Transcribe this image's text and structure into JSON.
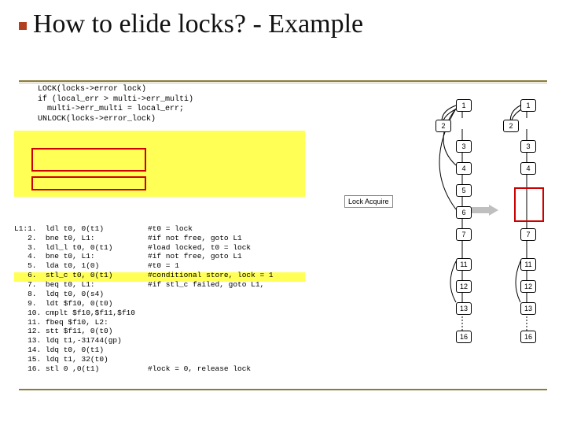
{
  "title": "How to elide locks? - Example",
  "c_code": "LOCK(locks->error lock)\nif (local_err > multi->err_multi)\n  multi->err_multi = local_err;\nUNLOCK(locks->error_lock)",
  "asm": {
    "label": "L1:",
    "lines": [
      {
        "n": "1.",
        "op": "ldl t0, 0(t1)",
        "c": "#t0 = lock"
      },
      {
        "n": "2.",
        "op": "bne t0, L1:",
        "c": "#if not free, goto L1"
      },
      {
        "n": "3.",
        "op": "ldl_l t0, 0(t1)",
        "c": "#load locked, t0 = lock"
      },
      {
        "n": "4.",
        "op": "bne t0, L1:",
        "c": "#if not free, goto L1"
      },
      {
        "n": "5.",
        "op": "lda t0, 1(0)",
        "c": "#t0 = 1"
      },
      {
        "n": "6.",
        "op": "stl_c t0, 0(t1)",
        "c": "#conditional store, lock = 1"
      },
      {
        "n": "7.",
        "op": "beq t0, L1:",
        "c": "#if stl_c failed, goto L1,"
      },
      {
        "n": "8.",
        "op": "ldq t0, 0(s4)",
        "c": ""
      },
      {
        "n": "9.",
        "op": "ldt $f10, 0(t0)",
        "c": ""
      },
      {
        "n": "10.",
        "op": "cmplt $f10,$f11,$f10",
        "c": ""
      },
      {
        "n": "11.",
        "op": "fbeq $f10, L2:",
        "c": ""
      },
      {
        "n": "12.",
        "op": "stt $f11, 0(t0)",
        "c": ""
      },
      {
        "n": "13.",
        "op": "ldq t1,-31744(gp)",
        "c": ""
      },
      {
        "n": "14.",
        "op": "ldq t0, 0(t1)",
        "c": ""
      },
      {
        "n": "15.",
        "op": "ldq t1, 32(t0)",
        "c": ""
      },
      {
        "n": "16.",
        "op": "stl 0 ,0(t1)",
        "c": "#lock = 0, release lock"
      }
    ]
  },
  "lock_label": "Lock Acquire",
  "graph": {
    "nodes": [
      "1",
      "2",
      "3",
      "4",
      "5",
      "6",
      "7",
      "11",
      "12",
      "13",
      "16"
    ]
  },
  "chart_data": [
    {
      "type": "diagram",
      "title": "Control-flow graph (original)",
      "nodes": [
        1,
        2,
        3,
        4,
        5,
        6,
        7,
        11,
        12,
        13,
        16
      ],
      "edges": [
        [
          1,
          2
        ],
        [
          2,
          1
        ],
        [
          1,
          3
        ],
        [
          3,
          4
        ],
        [
          4,
          1
        ],
        [
          4,
          5
        ],
        [
          5,
          6
        ],
        [
          6,
          1
        ],
        [
          6,
          7
        ],
        [
          7,
          11
        ],
        [
          11,
          12
        ],
        [
          12,
          13
        ],
        [
          13,
          16
        ],
        [
          11,
          13
        ]
      ]
    },
    {
      "type": "diagram",
      "title": "Control-flow graph (lock elided)",
      "nodes": [
        1,
        2,
        3,
        4,
        5,
        6,
        7,
        11,
        12,
        13,
        16
      ],
      "edges": [
        [
          1,
          3
        ],
        [
          3,
          4
        ],
        [
          4,
          7
        ],
        [
          7,
          11
        ],
        [
          11,
          12
        ],
        [
          12,
          13
        ],
        [
          13,
          16
        ],
        [
          11,
          13
        ]
      ],
      "removed_nodes": [
        5,
        6
      ]
    }
  ]
}
